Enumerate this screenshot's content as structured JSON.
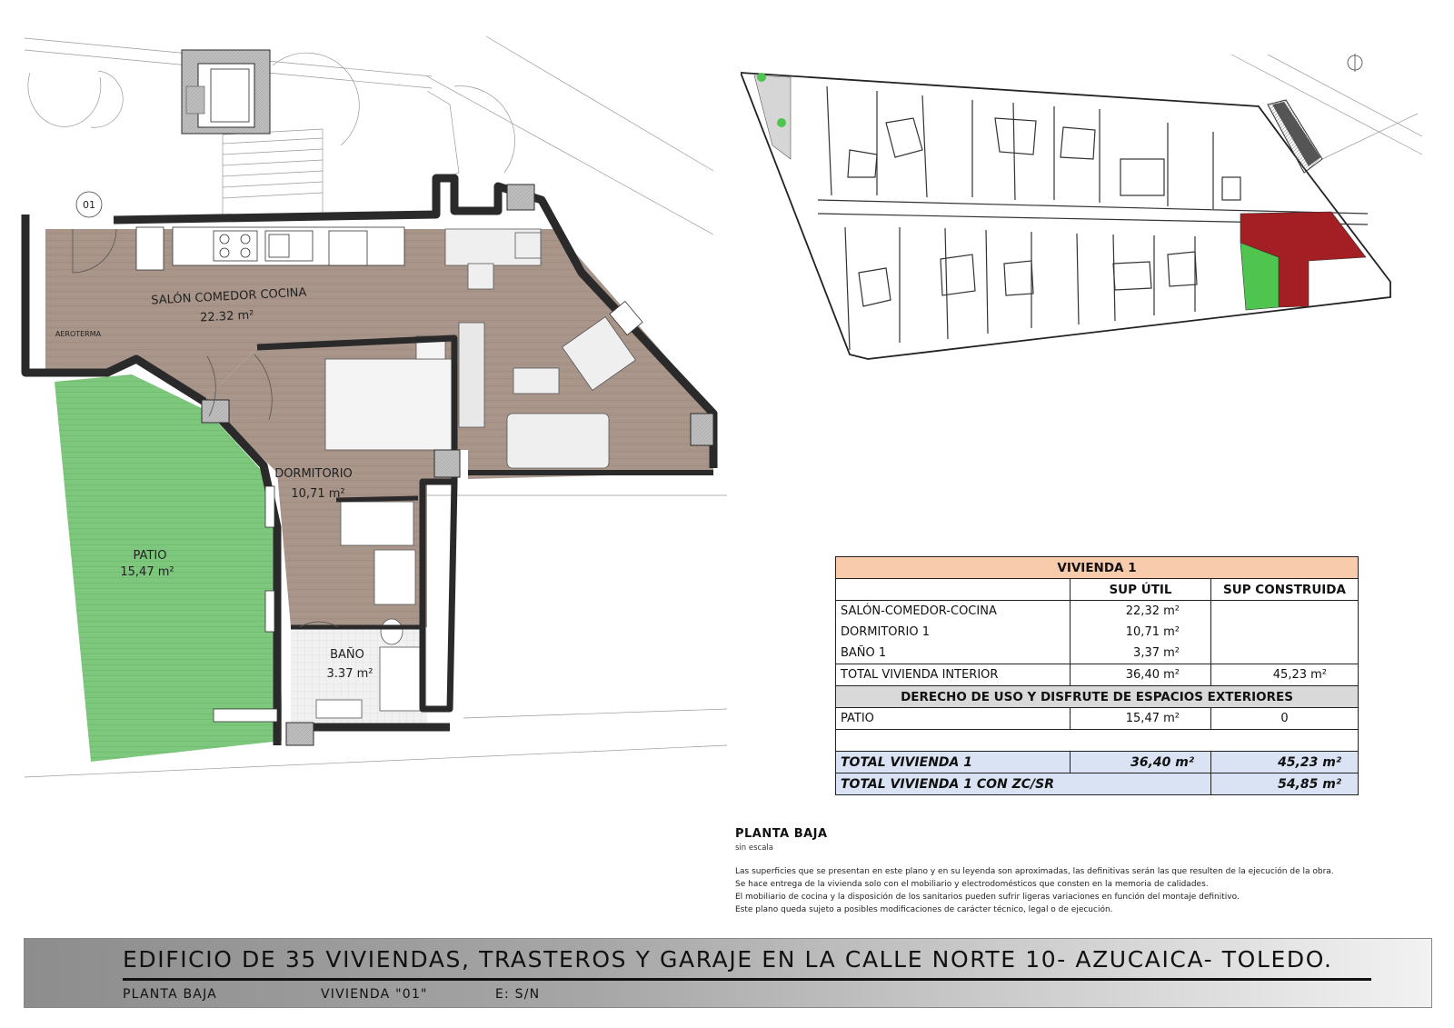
{
  "plan": {
    "unit_number": "01",
    "rooms": {
      "living": {
        "name": "SALÓN COMEDOR COCINA",
        "area": "22.32 m²"
      },
      "bedroom": {
        "name": "DORMITORIO",
        "area": "10,71 m²"
      },
      "patio": {
        "name": "PATIO",
        "area": "15,47 m²"
      },
      "bath": {
        "name": "BAÑO",
        "area": "3.37 m²"
      }
    },
    "equipment_label": "AEROTERMA"
  },
  "colors": {
    "wall": "#2a2a2a",
    "wood_floor": "#a89488",
    "patio_green": "#7ec87e",
    "bath_floor": "#ececec",
    "private_red": "#a31f24",
    "private_green": "#4fc44f",
    "table_title_bg": "#f8cbad",
    "table_total_bg": "#dae3f3"
  },
  "site_plan": {
    "icons": [
      "north-arrow-icon",
      "tree-icon"
    ]
  },
  "area_table": {
    "title": "VIVIENDA 1",
    "col_util": "SUP ÚTIL",
    "col_built": "SUP CONSTRUIDA",
    "rows": [
      {
        "label": "SALÓN-COMEDOR-COCINA",
        "util": "22,32  m²",
        "built": ""
      },
      {
        "label": "DORMITORIO 1",
        "util": "10,71  m²",
        "built": ""
      },
      {
        "label": "BAÑO 1",
        "util": "3,37  m²",
        "built": ""
      },
      {
        "label": "TOTAL VIVIENDA INTERIOR",
        "util": "36,40  m²",
        "built": "45,23  m²"
      }
    ],
    "exterior_header": "DERECHO DE USO Y DISFRUTE DE ESPACIOS EXTERIORES",
    "exterior_rows": [
      {
        "label": "PATIO",
        "util": "15,47  m²",
        "built": "0"
      }
    ],
    "total": {
      "label": "TOTAL VIVIENDA 1",
      "util": "36,40  m²",
      "built": "45,23  m²"
    },
    "total_zc": {
      "label": "TOTAL VIVIENDA 1 CON ZC/SR",
      "built": "54,85  m²"
    }
  },
  "caption": {
    "plan_name": "PLANTA BAJA",
    "scale": "sin escala",
    "notes": [
      "Las superficies que se presentan en este plano y en su leyenda son aproximadas, las definitivas serán las que resulten de la ejecución de la obra.",
      "Se hace entrega de la vivienda solo con el mobiliario y electrodomésticos que consten en la memoria de calidades.",
      "El mobiliario de cocina y la disposición de los sanitarios pueden sufrir ligeras variaciones en función del montaje definitivo.",
      "Este plano queda sujeto a posibles modificaciones de carácter técnico, legal o de ejecución."
    ]
  },
  "title_block": {
    "project": "EDIFICIO DE 35 VIVIENDAS, TRASTEROS Y GARAJE EN LA CALLE NORTE 10- AZUCAICA-  TOLEDO.",
    "floor": "PLANTA BAJA",
    "unit": "VIVIENDA \"01\"",
    "scale": "E: S/N"
  }
}
